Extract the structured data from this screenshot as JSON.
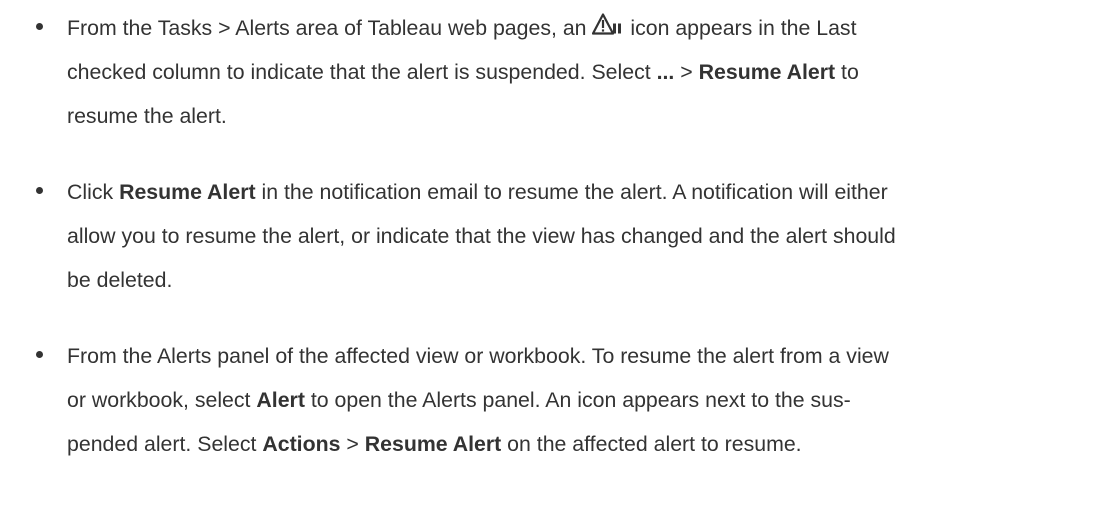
{
  "items": [
    {
      "lines": [
        {
          "a": "From the Tasks > Alerts area of Tableau web pages, an ",
          "b": " icon appears in the Last"
        },
        {
          "a": "checked column to indicate that the alert is suspended. Select ",
          "b": "...",
          "c": " > ",
          "d": "Resume Alert",
          "e": " to"
        },
        {
          "a": "resume the alert."
        }
      ],
      "icon": "suspended-alert-warning-icon"
    },
    {
      "lines": [
        {
          "a": "Click ",
          "b": "Resume Alert",
          "c": " in the notification email to resume the alert. A notification will either"
        },
        {
          "a": "allow you to resume the alert, or indicate that the view has changed and the alert should"
        },
        {
          "a": "be deleted."
        }
      ]
    },
    {
      "lines": [
        {
          "a": "From the Alerts panel of the affected view or workbook. To resume the alert from a view"
        },
        {
          "a": "or workbook, select ",
          "b": "Alert",
          "c": " to open the Alerts panel. An icon appears next to the sus-"
        },
        {
          "a": "pended alert. Select ",
          "b": "Actions",
          "c": " > ",
          "d": "Resume Alert",
          "e": " on the affected alert to resume."
        }
      ]
    }
  ]
}
